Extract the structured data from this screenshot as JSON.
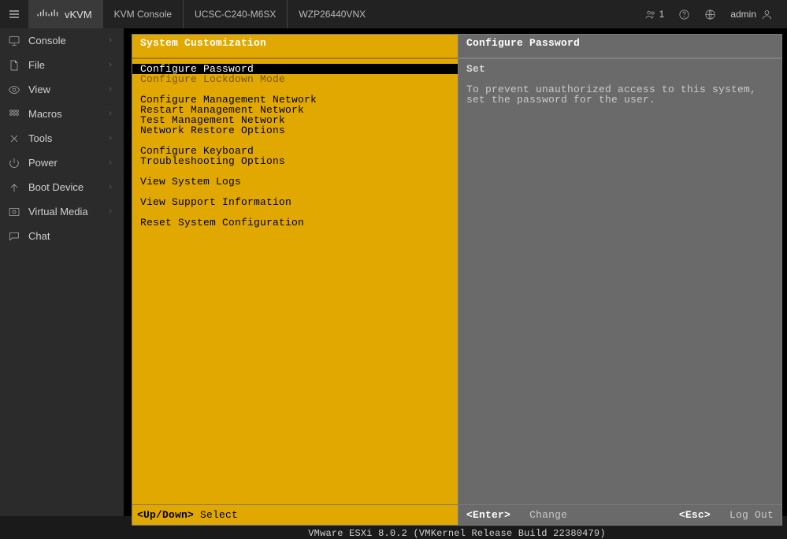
{
  "header": {
    "product": "vKVM",
    "crumbs": [
      "KVM Console",
      "UCSC-C240-M6SX",
      "WZP26440VNX"
    ],
    "users_count": "1",
    "admin_label": "admin"
  },
  "sidebar": {
    "items": [
      {
        "label": "Console",
        "icon": "monitor-icon",
        "expandable": true
      },
      {
        "label": "File",
        "icon": "file-icon",
        "expandable": true
      },
      {
        "label": "View",
        "icon": "eye-icon",
        "expandable": true
      },
      {
        "label": "Macros",
        "icon": "grid-icon",
        "expandable": true
      },
      {
        "label": "Tools",
        "icon": "tools-icon",
        "expandable": true
      },
      {
        "label": "Power",
        "icon": "power-icon",
        "expandable": true
      },
      {
        "label": "Boot Device",
        "icon": "arrow-up-icon",
        "expandable": true
      },
      {
        "label": "Virtual Media",
        "icon": "disc-icon",
        "expandable": true
      },
      {
        "label": "Chat",
        "icon": "chat-icon",
        "expandable": false
      }
    ]
  },
  "dcui": {
    "left_title": "System Customization",
    "menu_groups": [
      [
        {
          "label": "Configure Password",
          "selected": true
        },
        {
          "label": "Configure Lockdown Mode",
          "grey": true
        }
      ],
      [
        {
          "label": "Configure Management Network"
        },
        {
          "label": "Restart Management Network"
        },
        {
          "label": "Test Management Network"
        },
        {
          "label": "Network Restore Options"
        }
      ],
      [
        {
          "label": "Configure Keyboard"
        },
        {
          "label": "Troubleshooting Options"
        }
      ],
      [
        {
          "label": "View System Logs"
        }
      ],
      [
        {
          "label": "View Support Information"
        }
      ],
      [
        {
          "label": "Reset System Configuration"
        }
      ]
    ],
    "right_title": "Configure Password",
    "right_subhead": "Set",
    "right_desc": "To prevent unauthorized access to this system, set the password for the user.",
    "foot_left_key": "<Up/Down>",
    "foot_left_label": "Select",
    "foot_right_enter_key": "<Enter>",
    "foot_right_enter_label": "Change",
    "foot_right_esc_key": "<Esc>",
    "foot_right_esc_label": "Log Out",
    "statusbar": "VMware ESXi 8.0.2 (VMKernel Release Build 22380479)"
  }
}
